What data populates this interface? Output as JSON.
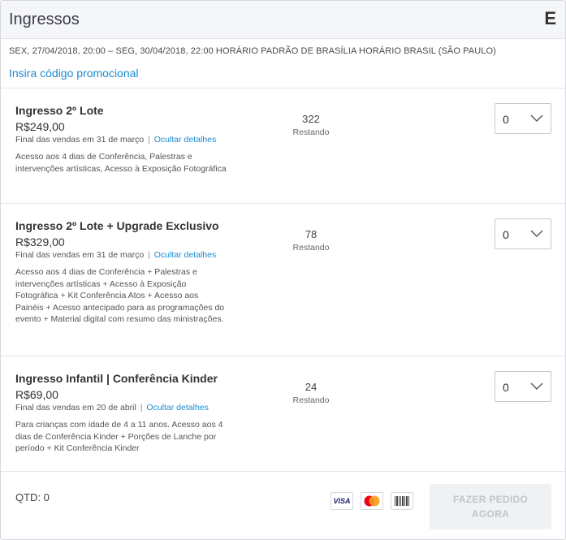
{
  "header": {
    "title": "Ingressos",
    "close_label": "E"
  },
  "event": {
    "datetime": "SEX, 27/04/2018, 20:00 – SEG, 30/04/2018, 22:00 HORÁRIO PADRÃO DE BRASÍLIA HORÁRIO BRASIL (SÃO PAULO)",
    "promo_link": "Insira código promocional"
  },
  "tickets": [
    {
      "name": "Ingresso 2º Lote",
      "price": "R$249,00",
      "sales_end": "Final das vendas em 31 de março",
      "separator": "|",
      "details_toggle": "Ocultar detalhes",
      "description": "Acesso aos 4 dias de Conferência, Palestras e intervenções artísticas, Acesso à Exposição Fotográfica",
      "count": "322",
      "remaining_label": "Restando",
      "qty": "0"
    },
    {
      "name": "Ingresso 2º Lote + Upgrade Exclusivo",
      "price": "R$329,00",
      "sales_end": "Final das vendas em 31 de março",
      "separator": "|",
      "details_toggle": "Ocultar detalhes",
      "description": "Acesso aos 4 dias de Conferência + Palestras e intervenções artísticas + Acesso à Exposição Fotográfica + Kit Conferência Atos + Acesso aos Painéis + Acesso antecipado para as programações do evento + Material digital com resumo das ministrações.",
      "count": "78",
      "remaining_label": "Restando",
      "qty": "0"
    },
    {
      "name": "Ingresso Infantil | Conferência Kinder",
      "price": "R$69,00",
      "sales_end": "Final das vendas em 20 de abril",
      "separator": "|",
      "details_toggle": "Ocultar detalhes",
      "description": "Para crianças com idade de 4 a 11 anos. Acesso aos 4 dias de Conferência Kinder + Porções de Lanche por período + Kit Conferência Kinder",
      "count": "24",
      "remaining_label": "Restando",
      "qty": "0"
    }
  ],
  "footer": {
    "qtd": "QTD: 0",
    "visa": "VISA",
    "order_button_line1": "FAZER PEDIDO",
    "order_button_line2": "AGORA"
  },
  "colors": {
    "link": "#1a8bd0",
    "mastercard_red": "#eb001b",
    "mastercard_orange": "#f79e1b",
    "visa_blue": "#1a1f71"
  },
  "icons": [
    "chevron-down-icon",
    "visa-icon",
    "mastercard-icon",
    "boleto-icon"
  ]
}
